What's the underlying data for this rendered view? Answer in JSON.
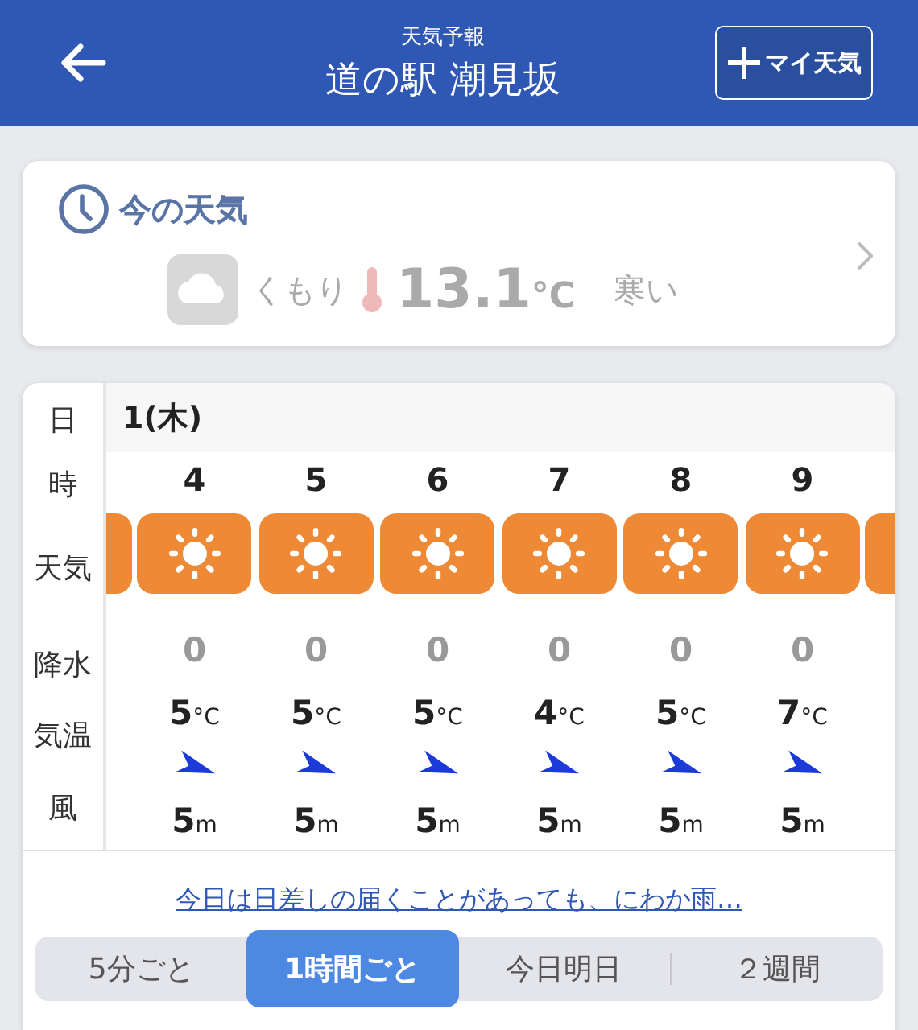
{
  "header": {
    "subtitle": "天気予報",
    "title": "道の駅 潮見坂",
    "my_weather_button": "マイ天気"
  },
  "current": {
    "heading": "今の天気",
    "disabled": true,
    "condition": "くもり",
    "temperature": "13.1",
    "unit": "°C",
    "feeling": "寒い"
  },
  "hourly": {
    "row_labels": [
      "日",
      "時",
      "天気",
      "降水",
      "気温",
      "風"
    ],
    "day": "1(木)",
    "hours": [
      {
        "hour": "4",
        "precip": "0",
        "temp": "5",
        "temp_unit": "°C",
        "wind": "5",
        "wind_unit": "m"
      },
      {
        "hour": "5",
        "precip": "0",
        "temp": "5",
        "temp_unit": "°C",
        "wind": "5",
        "wind_unit": "m"
      },
      {
        "hour": "6",
        "precip": "0",
        "temp": "5",
        "temp_unit": "°C",
        "wind": "5",
        "wind_unit": "m"
      },
      {
        "hour": "7",
        "precip": "0",
        "temp": "4",
        "temp_unit": "°C",
        "wind": "5",
        "wind_unit": "m"
      },
      {
        "hour": "8",
        "precip": "0",
        "temp": "5",
        "temp_unit": "°C",
        "wind": "5",
        "wind_unit": "m"
      },
      {
        "hour": "9",
        "precip": "0",
        "temp": "7",
        "temp_unit": "°C",
        "wind": "5",
        "wind_unit": "m"
      }
    ]
  },
  "summary_link": "今日は日差しの届くことがあっても、にわか雨…",
  "tabs": [
    {
      "label": "5分ごと",
      "selected": false
    },
    {
      "label": "1時間ごと",
      "selected": true
    },
    {
      "label": "今日明日",
      "selected": false
    },
    {
      "label": "２週間",
      "selected": false
    }
  ]
}
